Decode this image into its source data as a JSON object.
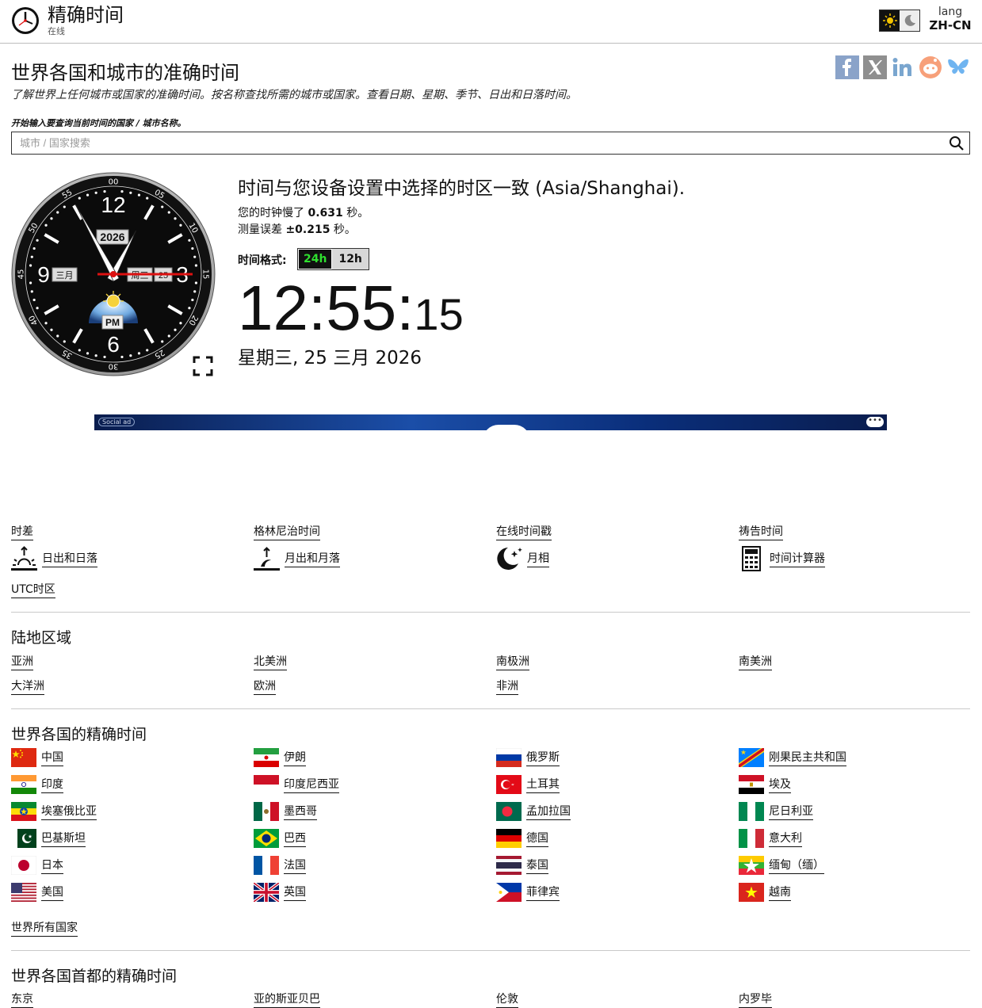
{
  "header": {
    "site_title": "精确时间",
    "site_subtitle": "在线",
    "lang_label": "lang",
    "lang_code": "ZH-CN"
  },
  "main": {
    "title": "世界各国和城市的准确时间",
    "intro": "了解世界上任何城市或国家的准确时间。按名称查找所需的城市或国家。查看日期、星期、季节、日出和日落时间。",
    "search_label": "开始输入要查询当前时间的国家 / 城市名称。",
    "search_placeholder": "城市 / 国家搜索"
  },
  "share": [
    "facebook-icon",
    "x-icon",
    "linkedin-icon",
    "reddit-icon",
    "bluesky-icon"
  ],
  "clock": {
    "year": "2026",
    "month": "三月",
    "weekday": "周三",
    "day": "25",
    "ampm": "PM",
    "hours": 12,
    "minutes": 55,
    "seconds": 15,
    "numbers": {
      "n12": "12",
      "n3": "3",
      "n6": "6",
      "n9": "9"
    },
    "bezel": [
      "00",
      "05",
      "10",
      "15",
      "20",
      "25",
      "30",
      "35",
      "40",
      "45",
      "50",
      "55"
    ]
  },
  "time_info": {
    "tz_message": "时间与您设备设置中选择的时区一致 (Asia/Shanghai).",
    "slow_prefix": "您的时钟慢了",
    "slow_value": "0.631",
    "slow_unit": "秒。",
    "error_prefix": "测量误差",
    "error_value": "±0.215",
    "error_unit": "秒。",
    "format_label": "时间格式:",
    "format_24": "24h",
    "format_12": "12h",
    "hm": "12:55:",
    "ss": "15",
    "date": "星期三, 25 三月 2026"
  },
  "ad": {
    "tag": "Social ad",
    "dots": "•••"
  },
  "tools": {
    "time_diff": "时差",
    "gmt": "格林尼治时间",
    "timestamp": "在线时间戳",
    "prayer": "祷告时间",
    "sunrise": "日出和日落",
    "moonrise": "月出和月落",
    "moonphase": "月相",
    "calculator": "时间计算器",
    "utc": "UTC时区"
  },
  "regions": {
    "title": "陆地区域",
    "items": [
      "亚洲",
      "北美洲",
      "南极洲",
      "南美洲",
      "大洋洲",
      "欧洲",
      "非洲"
    ]
  },
  "countries": {
    "title": "世界各国的精确时间",
    "items": [
      "中国",
      "伊朗",
      "俄罗斯",
      "刚果民主共和国",
      "印度",
      "印度尼西亚",
      "土耳其",
      "埃及",
      "埃塞俄比亚",
      "墨西哥",
      "孟加拉国",
      "尼日利亚",
      "巴基斯坦",
      "巴西",
      "德国",
      "意大利",
      "日本",
      "法国",
      "泰国",
      "缅甸（缅）",
      "美国",
      "英国",
      "菲律宾",
      "越南"
    ],
    "all": "世界所有国家"
  },
  "capitals": {
    "title": "世界各国首都的精确时间",
    "items": [
      "东京",
      "亚的斯亚贝巴",
      "伦敦",
      "内罗毕"
    ]
  }
}
